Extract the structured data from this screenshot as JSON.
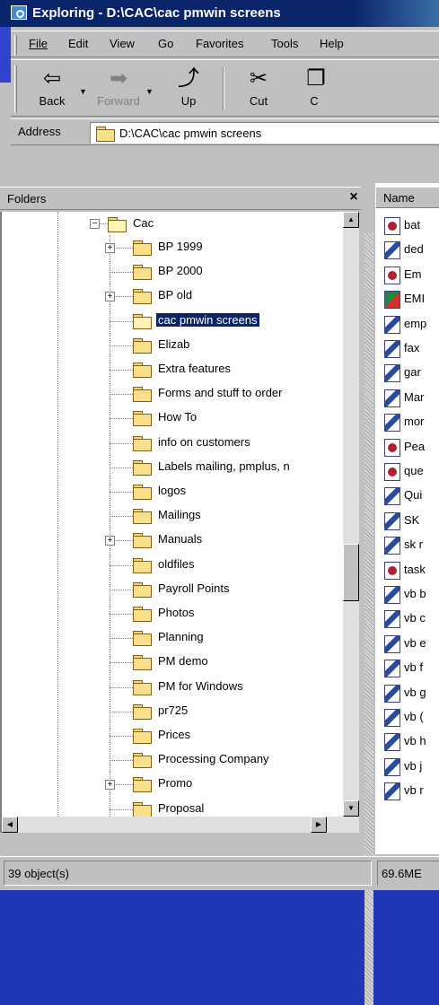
{
  "window": {
    "title": "Exploring - D:\\CAC\\cac pmwin screens"
  },
  "menu": [
    {
      "label": "File"
    },
    {
      "label": "Edit"
    },
    {
      "label": "View"
    },
    {
      "label": "Go"
    },
    {
      "label": "Favorites"
    },
    {
      "label": "Tools"
    },
    {
      "label": "Help"
    }
  ],
  "toolbar": {
    "back": "Back",
    "forward": "Forward",
    "up": "Up",
    "cut": "Cut",
    "copy": "C"
  },
  "address": {
    "label": "Address",
    "value": "D:\\CAC\\cac pmwin screens"
  },
  "folders_panel": {
    "title": "Folders",
    "close": "×",
    "root": "Cac",
    "items": [
      {
        "label": "BP 1999",
        "expandable": true
      },
      {
        "label": "BP 2000",
        "expandable": false
      },
      {
        "label": "BP old",
        "expandable": true
      },
      {
        "label": "cac pmwin screens",
        "expandable": false,
        "selected": true
      },
      {
        "label": "Elizab",
        "expandable": false
      },
      {
        "label": "Extra features",
        "expandable": false
      },
      {
        "label": "Forms and stuff to order",
        "expandable": false
      },
      {
        "label": "How To",
        "expandable": false
      },
      {
        "label": "info on customers",
        "expandable": false
      },
      {
        "label": "Labels mailing, pmplus, n",
        "expandable": false
      },
      {
        "label": "logos",
        "expandable": false
      },
      {
        "label": "Mailings",
        "expandable": false
      },
      {
        "label": "Manuals",
        "expandable": true
      },
      {
        "label": "oldfiles",
        "expandable": false
      },
      {
        "label": "Payroll Points",
        "expandable": false
      },
      {
        "label": "Photos",
        "expandable": false
      },
      {
        "label": "Planning",
        "expandable": false
      },
      {
        "label": "PM demo",
        "expandable": false
      },
      {
        "label": "PM for Windows",
        "expandable": false
      },
      {
        "label": "pr725",
        "expandable": false
      },
      {
        "label": "Prices",
        "expandable": false
      },
      {
        "label": "Processing Company",
        "expandable": false
      },
      {
        "label": "Promo",
        "expandable": true
      },
      {
        "label": "Proposal",
        "expandable": false
      }
    ]
  },
  "file_list": {
    "column_name": "Name",
    "files": [
      {
        "label": "bat",
        "icon": "doc"
      },
      {
        "label": "ded",
        "icon": "img"
      },
      {
        "label": "Em",
        "icon": "doc"
      },
      {
        "label": "EMI",
        "icon": "mdb"
      },
      {
        "label": "emp",
        "icon": "img"
      },
      {
        "label": "fax",
        "icon": "img"
      },
      {
        "label": "gar",
        "icon": "img"
      },
      {
        "label": "Mar",
        "icon": "img"
      },
      {
        "label": "mor",
        "icon": "img"
      },
      {
        "label": "Pea",
        "icon": "doc"
      },
      {
        "label": "que",
        "icon": "doc"
      },
      {
        "label": "Qui",
        "icon": "img"
      },
      {
        "label": "SK",
        "icon": "img"
      },
      {
        "label": "sk r",
        "icon": "img"
      },
      {
        "label": "task",
        "icon": "doc"
      },
      {
        "label": "vb b",
        "icon": "img"
      },
      {
        "label": "vb c",
        "icon": "img"
      },
      {
        "label": "vb e",
        "icon": "img"
      },
      {
        "label": "vb f",
        "icon": "img"
      },
      {
        "label": "vb g",
        "icon": "img"
      },
      {
        "label": "vb (",
        "icon": "img"
      },
      {
        "label": "vb h",
        "icon": "img"
      },
      {
        "label": "vb j",
        "icon": "img"
      },
      {
        "label": "vb r",
        "icon": "img"
      }
    ]
  },
  "status": {
    "objects": "39 object(s)",
    "size": "69.6ME"
  }
}
